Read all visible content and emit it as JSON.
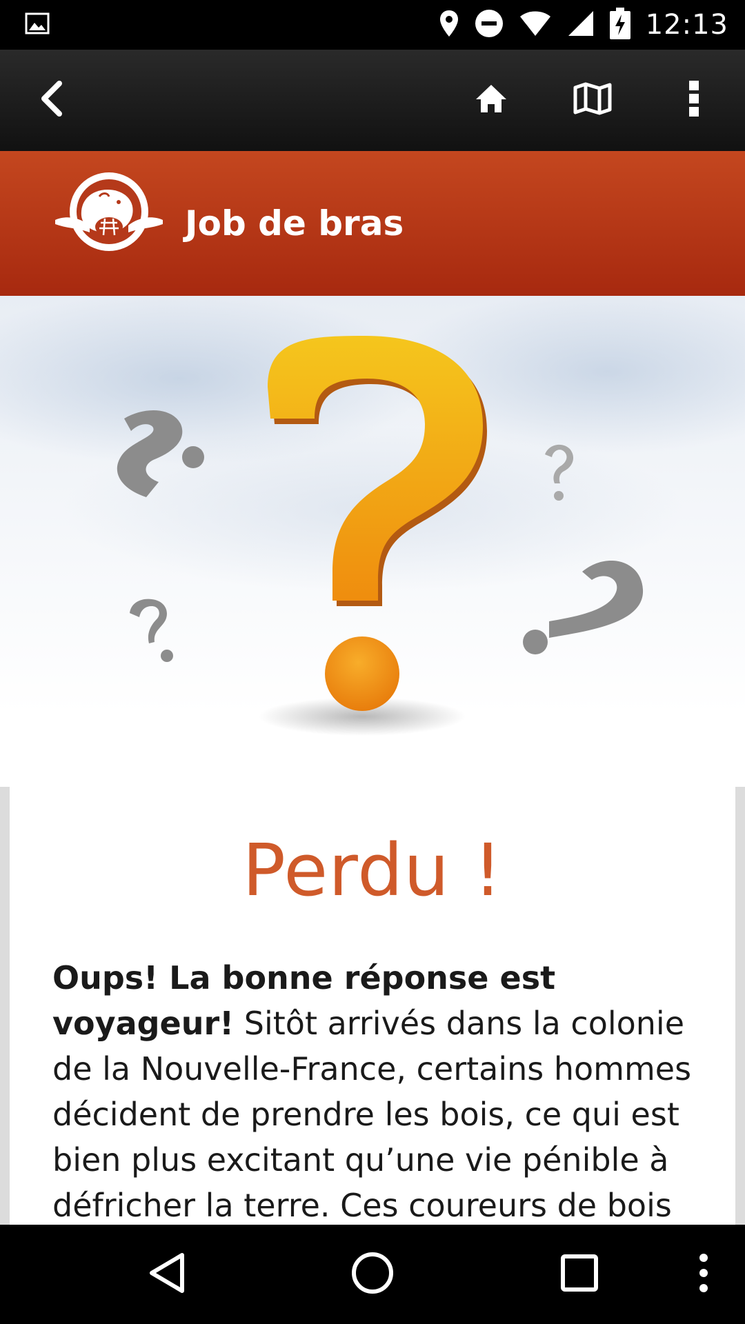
{
  "status_bar": {
    "time": "12:13",
    "icons": [
      "image-icon",
      "location-icon",
      "do-not-disturb-icon",
      "wifi-icon",
      "signal-icon",
      "battery-charging-icon"
    ]
  },
  "action_bar": {
    "icons": [
      "back-arrow-icon",
      "home-icon",
      "map-icon",
      "overflow-menu-icon"
    ]
  },
  "banner": {
    "title": "Job de bras",
    "logo_icon": "beaver-logo-icon",
    "color_top": "#c4471f",
    "color_bottom": "#a7290f"
  },
  "hero": {
    "illustration": "question-mark-illustration",
    "accent": "#f2a516"
  },
  "result": {
    "title": "Perdu !",
    "title_color": "#cf5a2a",
    "body_bold": "Oups! La bonne réponse est voyageur!",
    "body_text": " Sitôt arrivés dans la colonie de la Nouvelle-France, certains hommes décident de prendre les bois, ce qui est bien plus excitant qu’une vie pénible à défricher la terre. Ces coureurs de bois"
  },
  "nav_bar": {
    "icons": [
      "nav-back-icon",
      "nav-home-icon",
      "nav-recents-icon",
      "nav-menu-icon"
    ]
  }
}
